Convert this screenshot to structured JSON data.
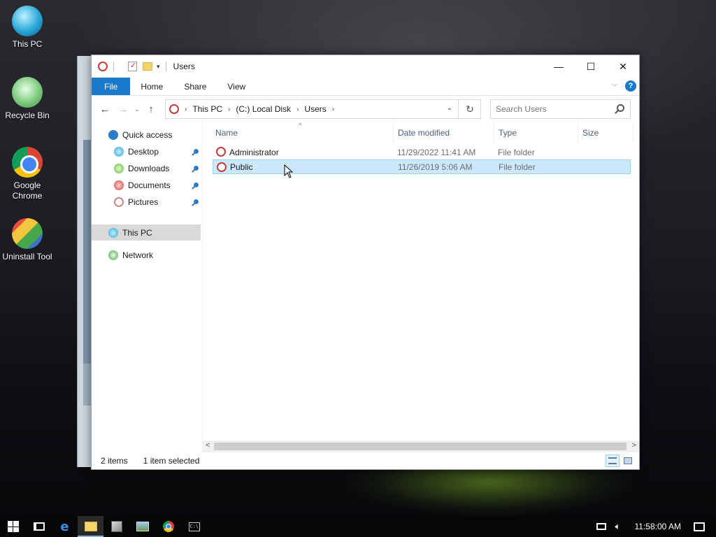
{
  "desktop": {
    "icons": [
      {
        "label": "This PC"
      },
      {
        "label": "Recycle Bin"
      },
      {
        "label": "Google Chrome"
      },
      {
        "label": "Uninstall Tool"
      }
    ]
  },
  "window": {
    "title": "Users",
    "controls": {
      "minimize": "—",
      "maximize": "☐",
      "close": "✕"
    }
  },
  "ribbon": {
    "tabs": [
      "File",
      "Home",
      "Share",
      "View"
    ],
    "help": "?"
  },
  "navbar": {
    "back": "←",
    "forward": "→",
    "recent": "⌄",
    "up": "↑",
    "breadcrumb": [
      "This PC",
      "(C:) Local Disk",
      "Users"
    ],
    "refresh": "↻",
    "search_placeholder": "Search Users"
  },
  "sidebar": {
    "quick_access": "Quick access",
    "pinned": [
      "Desktop",
      "Downloads",
      "Documents",
      "Pictures"
    ],
    "this_pc": "This PC",
    "network": "Network"
  },
  "columns": {
    "name": "Name",
    "date": "Date modified",
    "type": "Type",
    "size": "Size"
  },
  "files": [
    {
      "name": "Administrator",
      "date": "11/29/2022 11:41 AM",
      "type": "File folder",
      "selected": false
    },
    {
      "name": "Public",
      "date": "11/26/2019 5:06 AM",
      "type": "File folder",
      "selected": true
    }
  ],
  "status": {
    "items": "2 items",
    "selected": "1 item selected"
  },
  "taskbar": {
    "clock": "11:58:00 AM"
  },
  "colors": {
    "accent": "#1979ca",
    "selection": "#cce8ff",
    "selection_border": "#99d1ff"
  }
}
